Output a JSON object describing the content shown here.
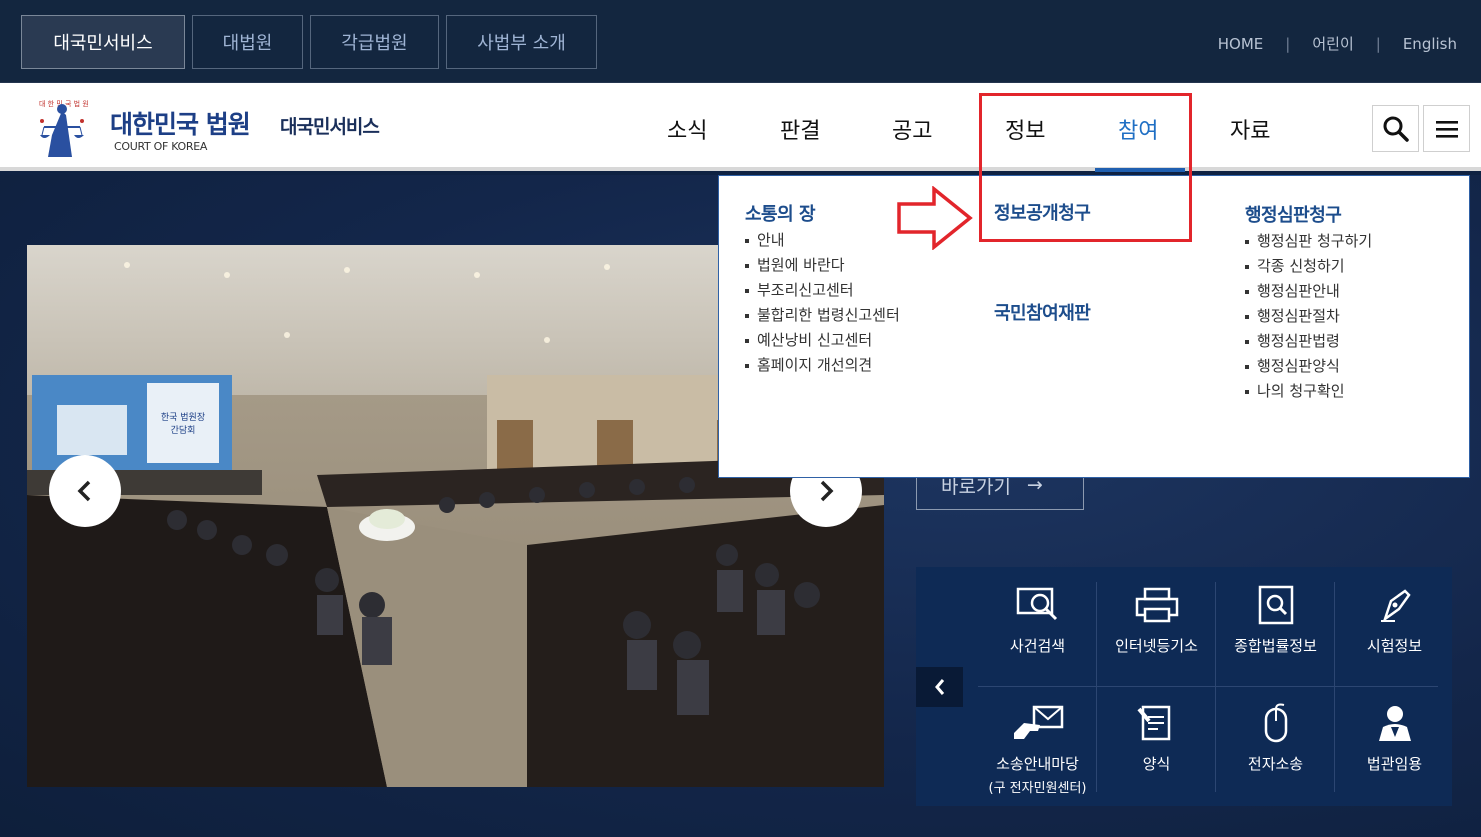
{
  "topbar": {
    "tabs": [
      {
        "label": "대국민서비스"
      },
      {
        "label": "대법원"
      },
      {
        "label": "각급법원"
      },
      {
        "label": "사법부 소개"
      }
    ],
    "links": [
      {
        "label": "HOME"
      },
      {
        "label": "어린이"
      },
      {
        "label": "English"
      }
    ]
  },
  "header": {
    "logo_title": "대한민국 법원",
    "logo_sub": "COURT OF KOREA",
    "logo_seal_text": "대한민국법원",
    "site_name": "대국민서비스",
    "nav": [
      {
        "label": "소식"
      },
      {
        "label": "판결"
      },
      {
        "label": "공고"
      },
      {
        "label": "정보"
      },
      {
        "label": "참여"
      },
      {
        "label": "자료"
      }
    ],
    "active_nav": "참여"
  },
  "slider": {
    "screen_text": "한국 법원장 간담회"
  },
  "shortcut": {
    "label": "바로가기",
    "arrow": "→"
  },
  "quick_menu": {
    "items": [
      {
        "label": "사건검색",
        "icon": "magnifier-monitor-icon"
      },
      {
        "label": "인터넷등기소",
        "icon": "printer-icon"
      },
      {
        "label": "종합법률정보",
        "icon": "document-search-icon"
      },
      {
        "label": "시험정보",
        "icon": "pen-nib-icon"
      },
      {
        "label": "소송안내마당",
        "sub": "(구 전자민원센터)",
        "icon": "hand-envelope-icon"
      },
      {
        "label": "양식",
        "icon": "form-pencil-icon"
      },
      {
        "label": "전자소송",
        "icon": "mouse-icon"
      },
      {
        "label": "법관임용",
        "icon": "judge-person-icon"
      }
    ]
  },
  "dropdown": {
    "columns": [
      {
        "heading": "소통의 장",
        "items": [
          "안내",
          "법원에 바란다",
          "부조리신고센터",
          "불합리한 법령신고센터",
          "예산낭비 신고센터",
          "홈페이지 개선의견"
        ]
      },
      {
        "heading": "정보공개청구",
        "heading2": "국민참여재판",
        "items": []
      },
      {
        "heading": "행정심판청구",
        "items": [
          "행정심판 청구하기",
          "각종 신청하기",
          "행정심판안내",
          "행정심판절차",
          "행정심판법령",
          "행정심판양식",
          "나의 청구확인"
        ]
      }
    ]
  },
  "colors": {
    "accent": "#1f6fc4",
    "annotation": "#e2252b",
    "navy": "#13263f"
  }
}
